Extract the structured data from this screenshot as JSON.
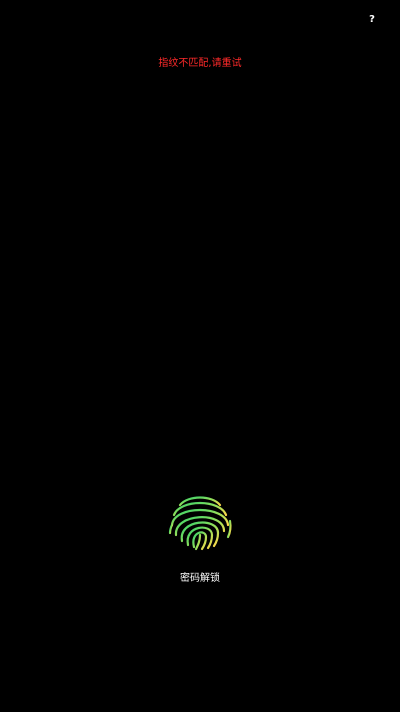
{
  "lock_screen": {
    "help_label": "?",
    "error_message": "指纹不匹配,请重试",
    "password_unlock_label": "密码解锁",
    "fingerprint_icon": "fingerprint-icon"
  },
  "colors": {
    "background": "#000000",
    "error_text": "#ff2a2a",
    "label_text": "#ffffff",
    "fingerprint_gradient": [
      "#2fd06b",
      "#9be05a",
      "#ffd84a"
    ]
  }
}
